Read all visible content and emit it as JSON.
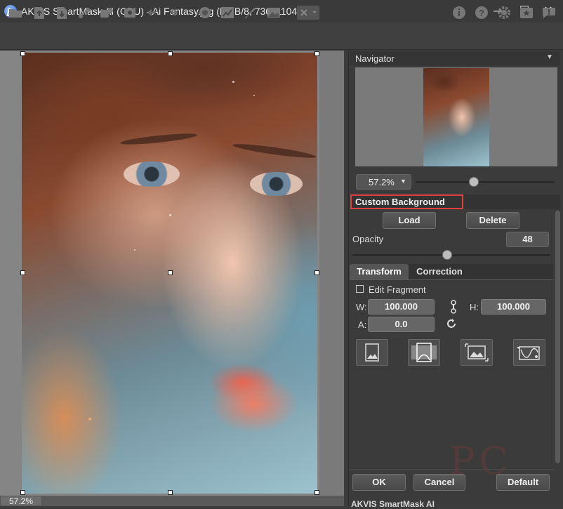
{
  "window": {
    "title": "AKVIS SmartMask AI (CPU) - Ai Fantasy.jpg (RGB/8, 736x1104)",
    "minimize": "—",
    "maximize": "☐",
    "close": "✕"
  },
  "toolbar": {
    "left_icons": [
      "open-icon",
      "upload-icon",
      "save-icon",
      "share-icon",
      "batch-icon",
      "settings-gear-icon",
      "undo-icon",
      "redo-icon"
    ],
    "mid_icons": [
      "mask-icon",
      "chart-icon",
      "brush-icon",
      "landscape-icon",
      "scissors-icon"
    ],
    "right_icons": [
      "info-icon",
      "help-icon",
      "gear-icon",
      "star-icon",
      "chat-icon"
    ]
  },
  "canvas": {
    "zoom": "57.2%"
  },
  "navigator": {
    "title": "Navigator",
    "zoom": "57.2%",
    "zoom_level": 0.42
  },
  "custom_background": {
    "title": "Custom Background",
    "load_label": "Load",
    "delete_label": "Delete",
    "opacity_label": "Opacity",
    "opacity_value": "48",
    "opacity_level": 0.48
  },
  "tabs": {
    "transform": "Transform",
    "correction": "Correction"
  },
  "transform": {
    "edit_fragment_label": "Edit Fragment",
    "edit_fragment_checked": false,
    "w_label": "W:",
    "w_value": "100.000",
    "h_label": "H:",
    "h_value": "100.000",
    "a_label": "A:",
    "a_value": "0.0",
    "buttons": [
      "fit-original-icon",
      "fit-width-icon",
      "stretch-icon",
      "fill-icon"
    ]
  },
  "footer": {
    "ok_label": "OK",
    "cancel_label": "Cancel",
    "default_label": "Default",
    "panel_title": "AKVIS SmartMask AI"
  }
}
